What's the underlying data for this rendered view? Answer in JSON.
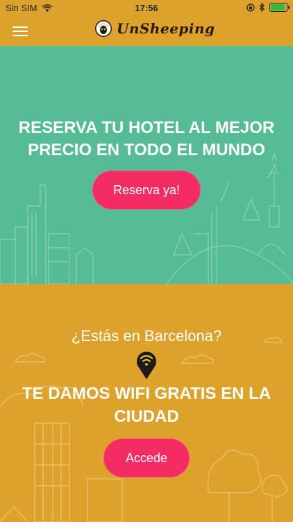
{
  "status_bar": {
    "carrier": "Sin SIM",
    "time": "17:56",
    "icons": [
      "wifi-icon",
      "orientation-lock-icon",
      "bluetooth-icon",
      "battery-icon"
    ]
  },
  "nav": {
    "menu_icon": "hamburger-icon",
    "brand_name": "UnSheeping",
    "logo_icon": "sheep-logo-icon"
  },
  "hero": {
    "title": "RESERVA TU HOTEL AL MEJOR PRECIO EN TODO EL MUNDO",
    "button_label": "Reserva ya!"
  },
  "wifi_section": {
    "question": "¿Estás en Barcelona?",
    "pin_icon": "wifi-pin-icon",
    "title": "TE DAMOS WIFI GRATIS EN LA CIUDAD",
    "button_label": "Accede"
  },
  "colors": {
    "nav_bg": "#DDA22C",
    "hero_bg": "#55BC96",
    "lower_bg": "#DDA22C",
    "accent_button": "#F42C63",
    "text_light": "#FFFFFF"
  }
}
